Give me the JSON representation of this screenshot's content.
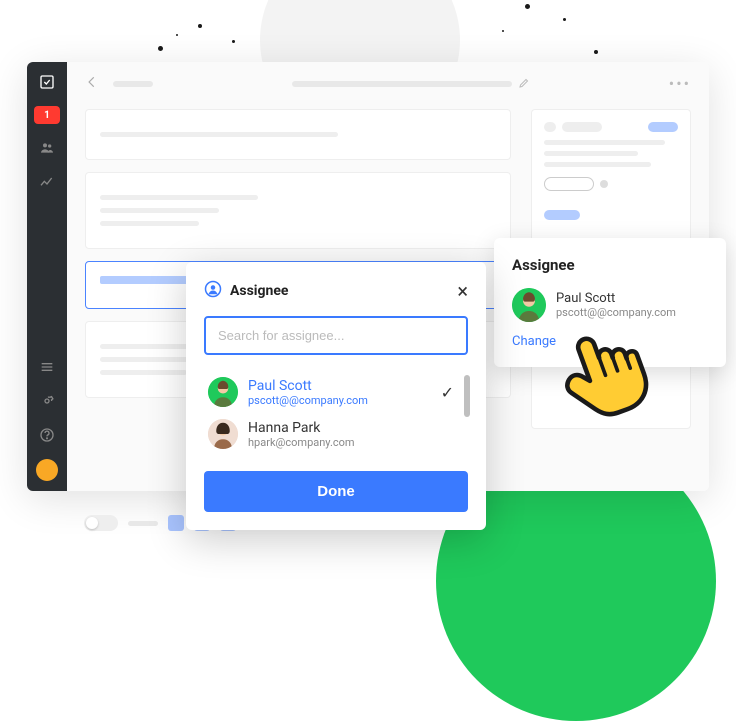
{
  "picker": {
    "title": "Assignee",
    "search_placeholder": "Search for assignee...",
    "done_label": "Done",
    "options": [
      {
        "name": "Paul Scott",
        "email": "pscott@@company.com",
        "selected": true
      },
      {
        "name": "Hanna Park",
        "email": "hpark@company.com",
        "selected": false
      }
    ]
  },
  "assignee_card": {
    "title": "Assignee",
    "name": "Paul Scott",
    "email": "pscott@@company.com",
    "change_label": "Change"
  },
  "rail": {
    "badge": "1"
  },
  "colors": {
    "accent": "#3a7aff",
    "danger": "#ff3a30",
    "success": "#1fc95b"
  }
}
